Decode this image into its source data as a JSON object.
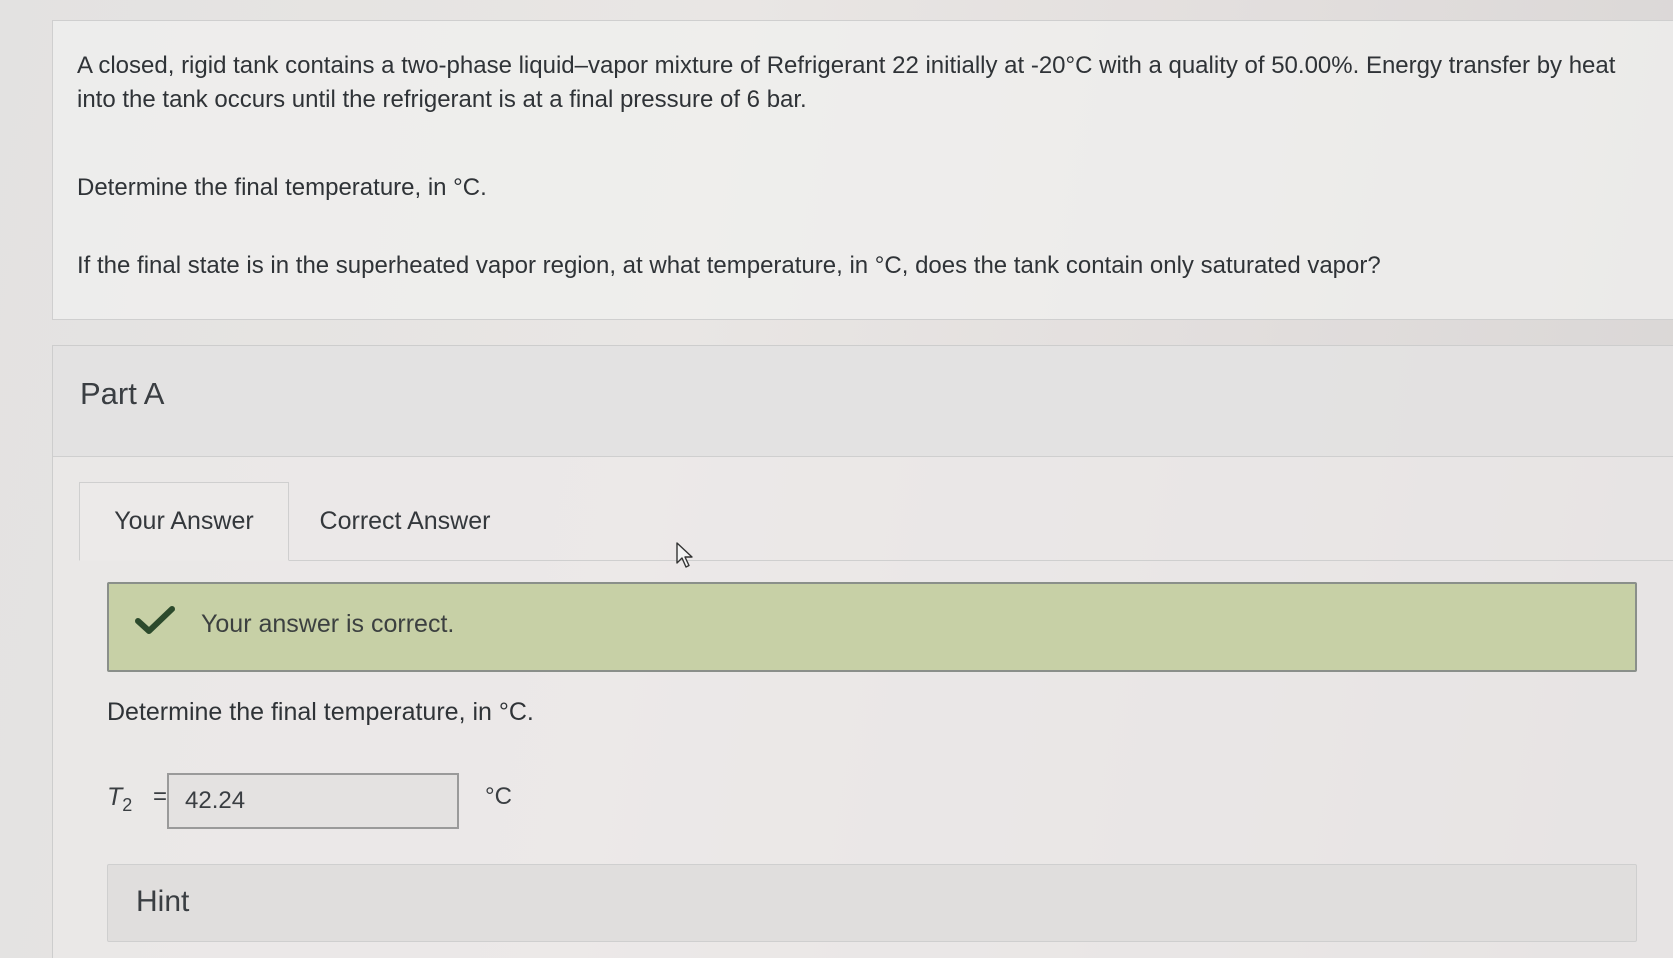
{
  "question": {
    "intro": "A closed, rigid tank contains a two-phase liquid–vapor mixture of Refrigerant 22 initially at -20°C with a quality of 50.00%. Energy transfer by heat into the tank occurs until the refrigerant is at a final pressure of 6 bar.",
    "ask1": "Determine the final temperature, in °C.",
    "ask2": "If the final state is in the superheated vapor region, at what temperature, in °C, does the tank contain only saturated vapor?"
  },
  "part": {
    "title": "Part A",
    "tabs": [
      {
        "label": "Your Answer",
        "active": true
      },
      {
        "label": "Correct Answer",
        "active": false
      }
    ],
    "feedback": {
      "text": "Your answer is correct.",
      "icon": "checkmark-icon",
      "color": "#c7d0a6"
    },
    "sub_question": "Determine the final temperature, in °C.",
    "answer": {
      "variable": "T",
      "subscript": "2",
      "equals": "=",
      "value": "42.24",
      "unit": "°C"
    },
    "hint_label": "Hint"
  },
  "colors": {
    "check": "#2c4a2c",
    "feedback_bg": "#c7d0a6",
    "text": "#2f3337"
  }
}
